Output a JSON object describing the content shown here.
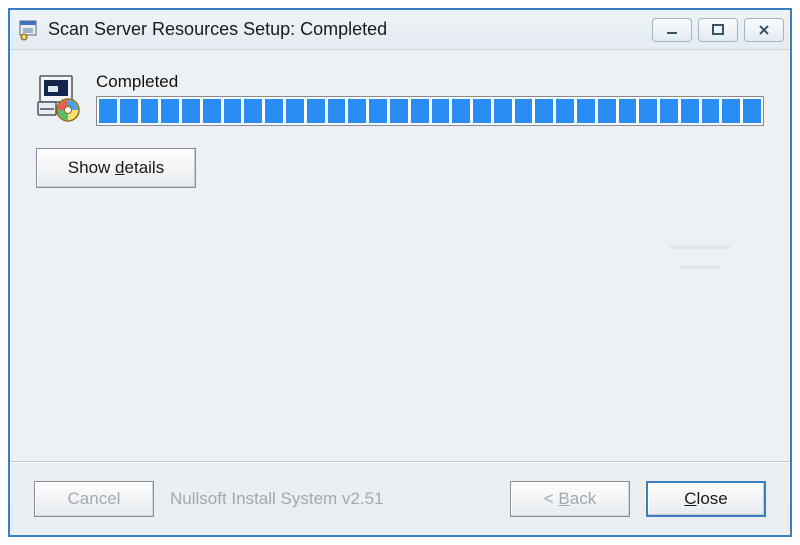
{
  "window": {
    "title": "Scan Server Resources Setup: Completed"
  },
  "status": {
    "label": "Completed",
    "progress_percent": 100,
    "progress_segments": 32
  },
  "buttons": {
    "show_details_pre": "Show ",
    "show_details_ul": "d",
    "show_details_post": "etails",
    "cancel": "Cancel",
    "back_pre": "< ",
    "back_ul": "B",
    "back_post": "ack",
    "close_ul": "C",
    "close_post": "lose"
  },
  "footer": {
    "branding": "Nullsoft Install System v2.51"
  }
}
